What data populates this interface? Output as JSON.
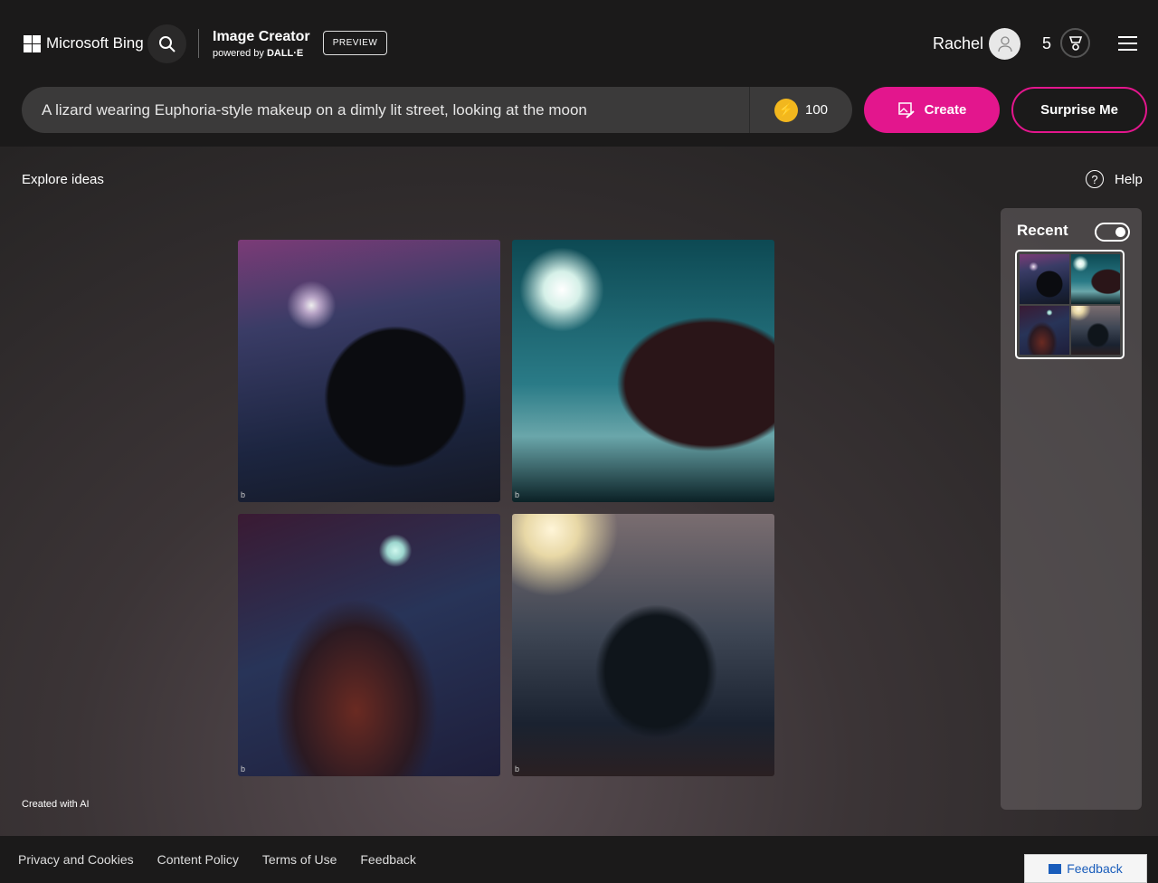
{
  "header": {
    "brand": "Microsoft Bing",
    "app_title": "Image Creator",
    "powered_by": "powered by",
    "dalle": "DALL·E",
    "badge": "PREVIEW",
    "user_name": "Rachel",
    "reward_count": "5"
  },
  "prompt": {
    "value": "A lizard wearing Euphoria-style makeup on a dimly lit street, looking at the moon",
    "boosts": "100"
  },
  "buttons": {
    "create": "Create",
    "surprise": "Surprise Me"
  },
  "main": {
    "explore": "Explore ideas",
    "help": "Help",
    "created_with_ai": "Created with AI",
    "image_watermark": "b"
  },
  "recent": {
    "title": "Recent",
    "toggle_on": true
  },
  "footer": {
    "links": [
      "Privacy and Cookies",
      "Content Policy",
      "Terms of Use",
      "Feedback"
    ],
    "feedback_button": "Feedback"
  },
  "colors": {
    "accent": "#e3168d",
    "background": "#1b1a1a"
  }
}
